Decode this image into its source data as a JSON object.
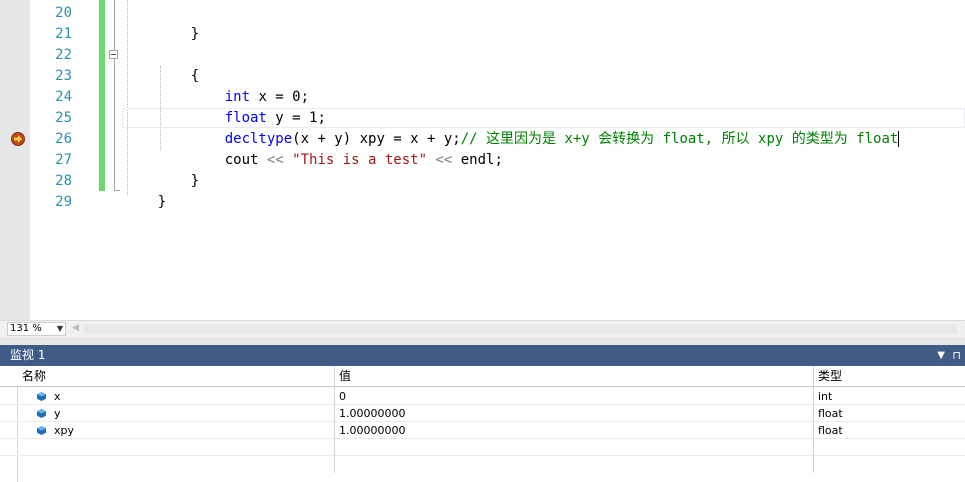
{
  "editor": {
    "line_numbers": [
      "20",
      "21",
      "22",
      "23",
      "24",
      "25",
      "26",
      "27",
      "28",
      "29"
    ],
    "lines": {
      "l20": "}",
      "l22": "{",
      "l23_kw": "int",
      "l23_rest": " x = 0;",
      "l24_kw": "float",
      "l24_rest": " y = 1;",
      "l25_kw": "decltype",
      "l25_rest": "(x + y) xpy = x + y;",
      "l25_comment": "// 这里因为是 x+y 会转换为 float, 所以 xpy 的类型为 float",
      "l26_a": "cout ",
      "l26_op1": "<<",
      "l26_str": " \"This is a test\" ",
      "l26_op2": "<<",
      "l26_b": " endl;",
      "l27": "}",
      "l28": "}"
    },
    "colors": {
      "keyword": "#0000ff",
      "string": "#a31515",
      "comment": "#008000",
      "line_number": "#2b91af"
    }
  },
  "zoom": {
    "value": "131 %"
  },
  "watch": {
    "title": "监视 1",
    "columns": {
      "name": "名称",
      "value": "值",
      "type": "类型"
    },
    "rows": [
      {
        "name": "x",
        "value": "0",
        "type": "int"
      },
      {
        "name": "y",
        "value": "1.00000000",
        "type": "float"
      },
      {
        "name": "xpy",
        "value": "1.00000000",
        "type": "float"
      }
    ]
  }
}
